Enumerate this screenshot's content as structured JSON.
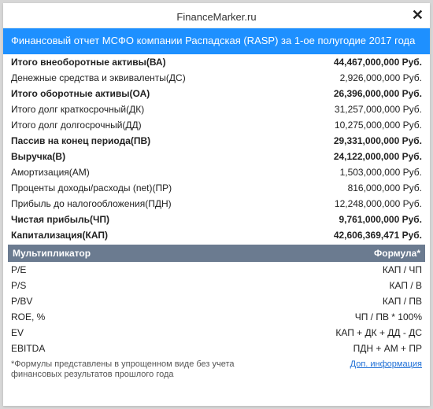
{
  "header": {
    "site_title": "FinanceMarker.ru",
    "close_glyph": "✕"
  },
  "banner": "Финансовый отчет МСФО компании Распадская (RASP) за 1-ое полугодие 2017 года",
  "currency_suffix": " Руб.",
  "financials": [
    {
      "label": "Итого внеоборотные активы(ВА)",
      "value": "44,467,000,000",
      "bold": true
    },
    {
      "label": "Денежные средства и эквиваленты(ДС)",
      "value": "2,926,000,000",
      "bold": false
    },
    {
      "label": "Итого оборотные активы(ОА)",
      "value": "26,396,000,000",
      "bold": true
    },
    {
      "label": "Итого долг краткосрочный(ДК)",
      "value": "31,257,000,000",
      "bold": false
    },
    {
      "label": "Итого долг долгосрочный(ДД)",
      "value": "10,275,000,000",
      "bold": false
    },
    {
      "label": "Пассив на конец периода(ПВ)",
      "value": "29,331,000,000",
      "bold": true
    },
    {
      "label": "Выручка(В)",
      "value": "24,122,000,000",
      "bold": true
    },
    {
      "label": "Амортизация(АМ)",
      "value": "1,503,000,000",
      "bold": false
    },
    {
      "label": "Проценты доходы/расходы (net)(ПР)",
      "value": "816,000,000",
      "bold": false
    },
    {
      "label": "Прибыль до налогообложения(ПДН)",
      "value": "12,248,000,000",
      "bold": false
    },
    {
      "label": "Чистая прибыль(ЧП)",
      "value": "9,761,000,000",
      "bold": true
    },
    {
      "label": "Капитализация(КАП)",
      "value": "42,606,369,471",
      "bold": true
    }
  ],
  "multiples_header": {
    "left": "Мультипликатор",
    "right": "Формула*"
  },
  "multiples": [
    {
      "label": "P/E",
      "formula": "КАП / ЧП"
    },
    {
      "label": "P/S",
      "formula": "КАП / В"
    },
    {
      "label": "P/BV",
      "formula": "КАП / ПВ"
    },
    {
      "label": "ROE, %",
      "formula": "ЧП / ПВ * 100%"
    },
    {
      "label": "EV",
      "formula": "КАП + ДК + ДД - ДС"
    },
    {
      "label": "EBITDA",
      "formula": "ПДН + АМ + ПР"
    }
  ],
  "footnote": "*Формулы представлены в упрощенном виде без учета финансовых результатов прошлого года",
  "more_link": "Доп. информация"
}
